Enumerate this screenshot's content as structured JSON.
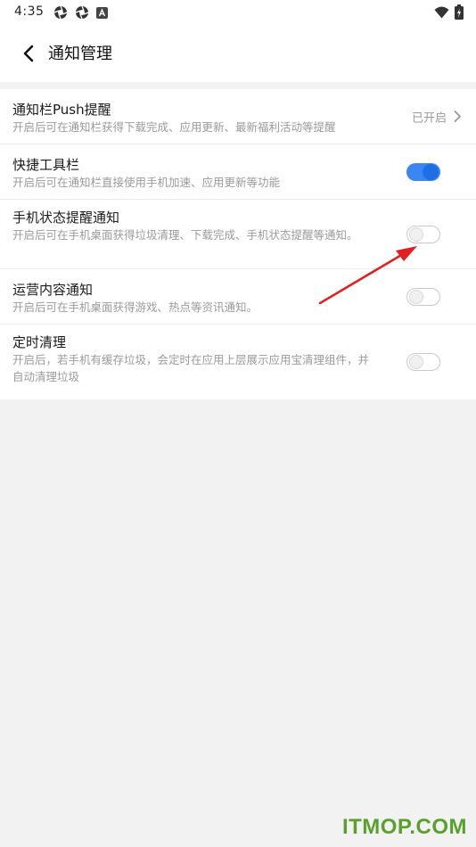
{
  "status_bar": {
    "time": "4:35",
    "left_icons": [
      "shutter-icon",
      "shutter-icon",
      "a-badge-icon"
    ],
    "right_icons": [
      "wifi-icon",
      "battery-charging-icon"
    ]
  },
  "header": {
    "title": "通知管理",
    "back_icon": "chevron-left-icon"
  },
  "settings": [
    {
      "title": "通知栏Push提醒",
      "desc": "开启后可在通知栏获得下载完成、应用更新、最新福利活动等提醒",
      "control": "link",
      "status": "已开启"
    },
    {
      "title": "快捷工具栏",
      "desc": "开启后可在通知栏直接使用手机加速、应用更新等功能",
      "control": "toggle",
      "on": true
    },
    {
      "title": "手机状态提醒通知",
      "desc": "开启后可在手机桌面获得垃圾清理、下载完成、手机状态提醒等通知。",
      "control": "toggle",
      "on": false
    },
    {
      "title": "运营内容通知",
      "desc": "开启后可在手机桌面获得游戏、热点等资讯通知。",
      "control": "toggle",
      "on": false
    },
    {
      "title": "定时清理",
      "desc": "开启后，若手机有缓存垃圾，会定时在应用上层展示应用宝清理组件，并自动清理垃圾",
      "control": "toggle",
      "on": false
    }
  ],
  "colors": {
    "accent": "#1e6fe6",
    "annotation_arrow": "#e02020",
    "watermark": "#5aa02c"
  },
  "watermark": "ITMOP.COM"
}
